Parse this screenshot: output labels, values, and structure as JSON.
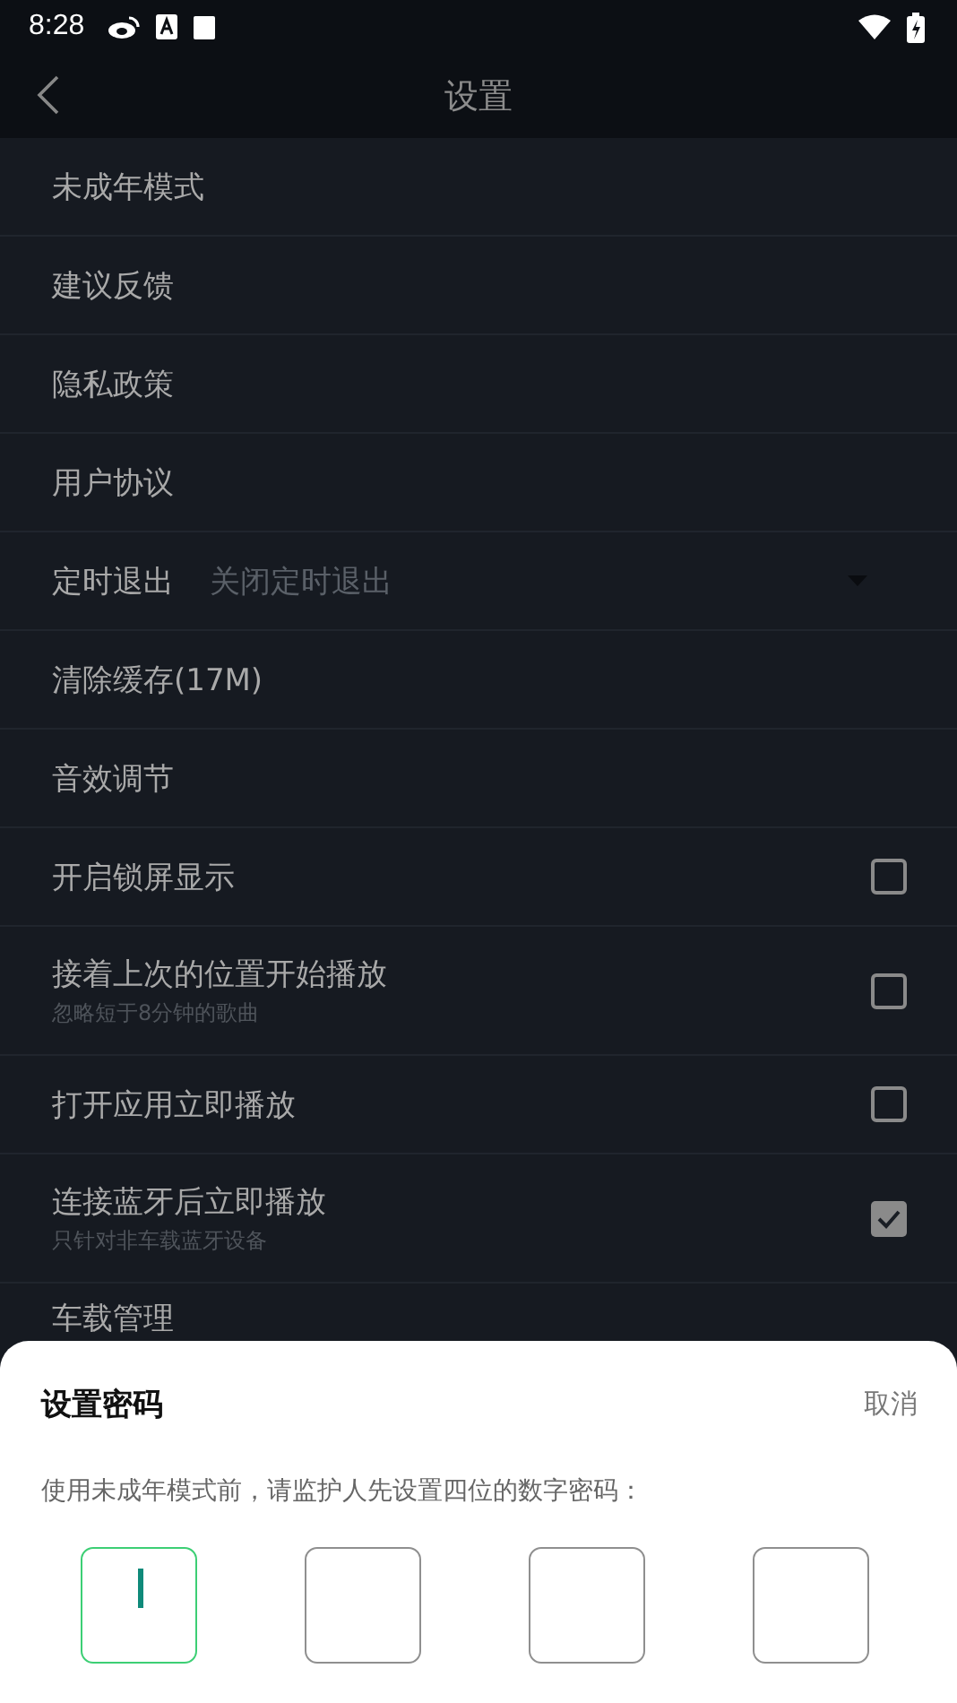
{
  "status_bar": {
    "time": "8:28"
  },
  "header": {
    "title": "设置"
  },
  "settings": [
    {
      "kind": "link",
      "label": "未成年模式"
    },
    {
      "kind": "link",
      "label": "建议反馈"
    },
    {
      "kind": "link",
      "label": "隐私政策"
    },
    {
      "kind": "link",
      "label": "用户协议"
    },
    {
      "kind": "dropdown",
      "label": "定时退出",
      "value": "关闭定时退出"
    },
    {
      "kind": "link",
      "label": "清除缓存(17M)"
    },
    {
      "kind": "link",
      "label": "音效调节"
    },
    {
      "kind": "checkbox",
      "label": "开启锁屏显示",
      "checked": false
    },
    {
      "kind": "checkbox",
      "label": "接着上次的位置开始播放",
      "subtitle": "忽略短于8分钟的歌曲",
      "checked": false
    },
    {
      "kind": "checkbox",
      "label": "打开应用立即播放",
      "checked": false
    },
    {
      "kind": "checkbox",
      "label": "连接蓝牙后立即播放",
      "subtitle": "只针对非车载蓝牙设备",
      "checked": true
    },
    {
      "kind": "link",
      "label": "车载管理"
    }
  ],
  "dialog": {
    "title": "设置密码",
    "cancel": "取消",
    "message": "使用未成年模式前，请监护人先设置四位的数字密码：",
    "digits": [
      {
        "selected": true
      },
      {
        "selected": false
      },
      {
        "selected": false
      },
      {
        "selected": false
      }
    ]
  }
}
